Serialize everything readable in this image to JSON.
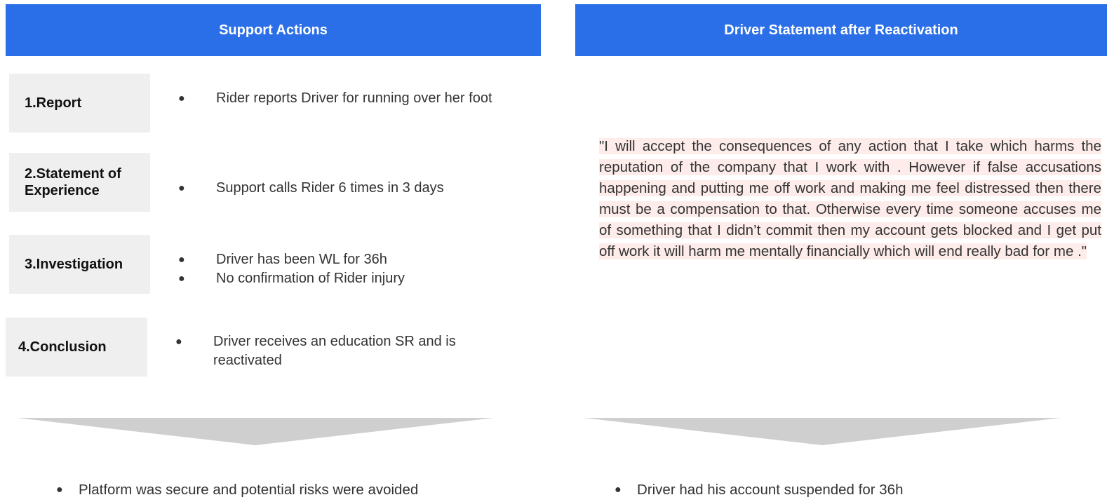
{
  "left": {
    "header": "Support Actions",
    "steps": [
      {
        "label": "1.Report",
        "bullets": [
          "Rider reports Driver for running over her foot"
        ]
      },
      {
        "label": "2.Statement of Experience",
        "bullets": [
          "Support calls Rider 6 times in 3 days"
        ]
      },
      {
        "label": "3.Investigation",
        "bullets": [
          "Driver has been WL for 36h",
          "No confirmation of Rider injury"
        ]
      },
      {
        "label": "4.Conclusion",
        "bullets": [
          "Driver receives an education SR and is reactivated"
        ]
      }
    ],
    "outcome": "Platform was secure and potential risks were avoided"
  },
  "right": {
    "header": "Driver Statement after Reactivation",
    "quote": "\"I will accept the consequences of any action that I take which harms the reputation of the company that I work with . However if false accusations happening and putting me off work and making me feel distressed then there must be a compensation to that. Otherwise every time someone accuses me of something that I didn’t commit then my account gets blocked and I get put off work it will harm me mentally financially which will end really bad for me .\"",
    "outcome": "Driver had his account suspended for 36h"
  },
  "colors": {
    "header_bg": "#2b6fe8",
    "label_bg": "#efefef",
    "arrow": "#cfcfcf",
    "highlight": "#fdecea"
  },
  "bullet_glyph": "●"
}
